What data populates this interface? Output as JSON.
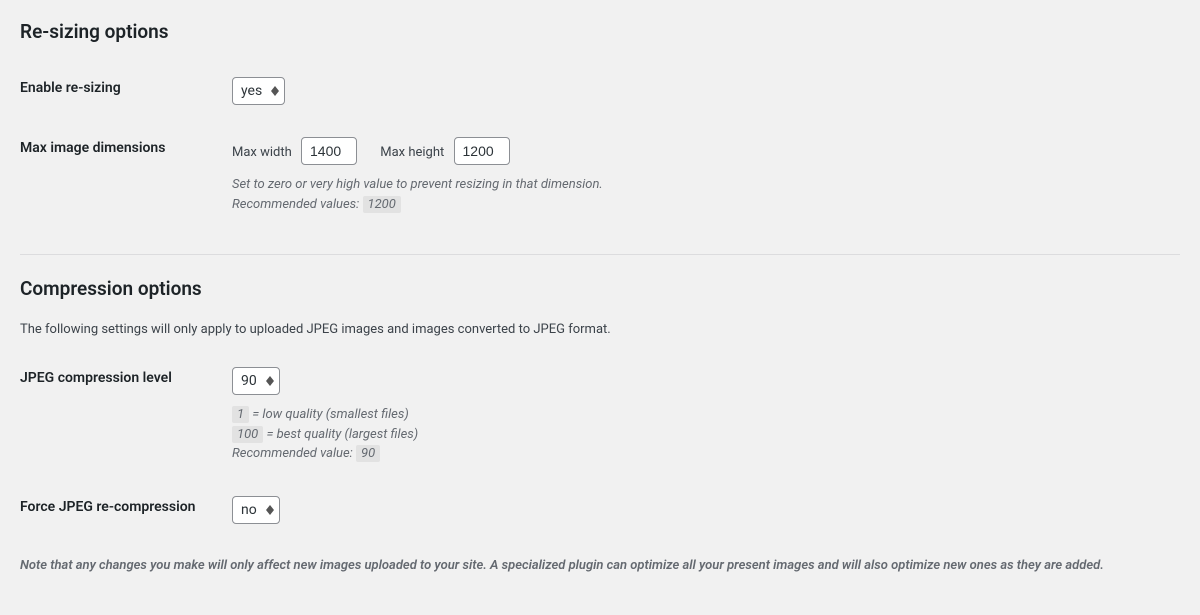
{
  "resizing": {
    "heading": "Re-sizing options",
    "enable": {
      "label": "Enable re-sizing",
      "value": "yes"
    },
    "dimensions": {
      "label": "Max image dimensions",
      "max_width_label": "Max width",
      "max_width_value": "1400",
      "max_height_label": "Max height",
      "max_height_value": "1200",
      "desc_line1": "Set to zero or very high value to prevent resizing in that dimension.",
      "desc_recommended_label": "Recommended values: ",
      "desc_recommended_value": "1200"
    }
  },
  "compression": {
    "heading": "Compression options",
    "intro": "The following settings will only apply to uploaded JPEG images and images converted to JPEG format.",
    "jpeg_level": {
      "label": "JPEG compression level",
      "value": "90",
      "low_code": "1",
      "low_text": " = low quality (smallest files)",
      "high_code": "100",
      "high_text": " = best quality (largest files)",
      "recommended_label": "Recommended value: ",
      "recommended_value": "90"
    },
    "force_recompress": {
      "label": "Force JPEG re-compression",
      "value": "no"
    },
    "note": "Note that any changes you make will only affect new images uploaded to your site. A specialized plugin can optimize all your present images and will also optimize new ones as they are added."
  }
}
